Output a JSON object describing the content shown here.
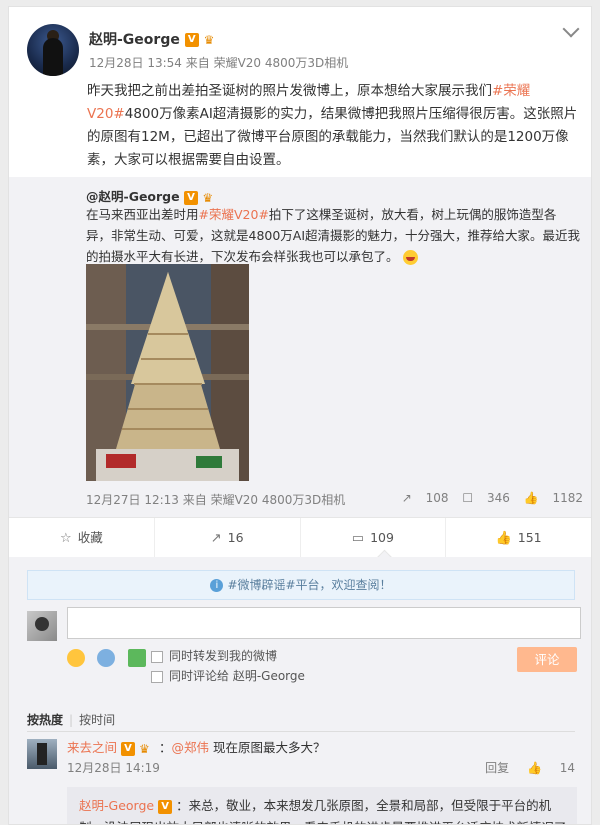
{
  "post": {
    "author": "赵明-George",
    "badge": "V",
    "meta": "12月28日 13:54 来自 荣耀V20 4800万3D相机",
    "text_parts": [
      "昨天我把之前出差拍圣诞树的照片发微博上，原本想给大家展示我们",
      "#荣耀V20#",
      "4800万像素AI超清摄影的实力，结果微博把我照片压缩得很厉害。这张照片的原图有12M，已超出了微博平台原图的承载能力，当然我们默认的是1200万像素，大家可以根据需要自由设置。"
    ]
  },
  "repost": {
    "author": "@赵明-George",
    "text_parts": [
      "在马来西亚出差时用",
      "#荣耀V20#",
      "拍下了这棵圣诞树，放大看，树上玩偶的服饰造型各异，非常生动、可爱，这就是4800万AI超清摄影的魅力，十分强大，推荐给大家。最近我的拍摄水平大有长进，下次发布会样张我也可以承包了。"
    ],
    "meta": "12月27日 12:13 来自 荣耀V20 4800万3D相机",
    "share_count": "108",
    "comment_count": "346",
    "like_count": "1182"
  },
  "actions": {
    "favorite": "收藏",
    "repost": "16",
    "comment": "109",
    "like": "151"
  },
  "comments": {
    "notice": "#微博辟谣#平台，欢迎查阅！",
    "input_placeholder": "",
    "opt_repost": "同时转发到我的微博",
    "opt_comment": "同时评论给 赵明-George",
    "submit": "评论",
    "sort_hot": "按热度",
    "sort_time": "按时间",
    "items": [
      {
        "name": "来去之间",
        "mention": "@郑伟",
        "text": "现在原图最大多大？",
        "meta": "12月28日 14:19",
        "reply": "回复",
        "likes": "14",
        "reply_author": "赵明-George",
        "reply_text": "：来总，敬业，本来想发几张原图，全景和局部，但受限于平台的机制，没法展现出放大局部也清晰的效果，看来手机的进步是要推进平台适应技术新情况了"
      }
    ]
  }
}
